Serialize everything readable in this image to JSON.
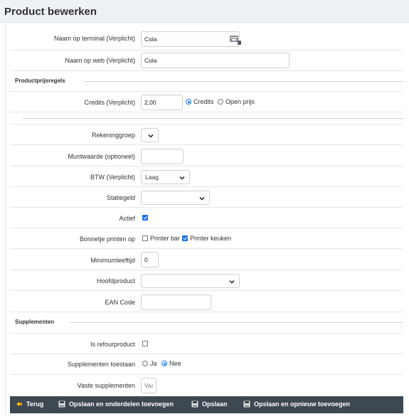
{
  "page": {
    "title": "Product bewerken"
  },
  "fields": {
    "naam_terminal": {
      "label": "Naam op terminal (Verplicht)",
      "value": "Cola"
    },
    "naam_web": {
      "label": "Naam op web (Verplicht)",
      "value": "Cola"
    },
    "credits": {
      "label": "Credits (Verplicht)",
      "value": "2,00",
      "option_credits": "Credits",
      "option_open": "Open prijs"
    },
    "rekeninggroep": {
      "label": "Rekeninggroep",
      "value": ""
    },
    "muntwaarde": {
      "label": "Muntwaarde (optioneel)",
      "value": ""
    },
    "btw": {
      "label": "BTW (Verplicht)",
      "value": "Laag"
    },
    "statiegeld": {
      "label": "Statiegeld",
      "value": ""
    },
    "actief": {
      "label": "Actief",
      "checked": true
    },
    "bonnetje": {
      "label": "Bonnetje printen op",
      "option_bar": "Printer bar",
      "option_keuken": "Printer keuken",
      "bar_checked": false,
      "keuken_checked": true
    },
    "minimumleeftijd": {
      "label": "Minimumleeftijd",
      "value": "0"
    },
    "hoofdproduct": {
      "label": "Hoofdproduct",
      "value": ""
    },
    "ean": {
      "label": "EAN Code",
      "value": ""
    },
    "refourproduct": {
      "label": "Is refourproduct",
      "checked": false
    },
    "supplementen_toestaan": {
      "label": "Supplementen toestaan",
      "option_ja": "Ja",
      "option_nee": "Nee",
      "selected": "Nee"
    },
    "vaste_supplementen": {
      "label": "Vaste supplementen",
      "placeholder": "Vaste"
    }
  },
  "sections": {
    "productprijsregels": "Productprijsregels",
    "supplementen": "Supplementen"
  },
  "footer": {
    "terug": "Terug",
    "opslaan_onderdelen": "Opslaan en onderdelen toevoegen",
    "opslaan": "Opslaan",
    "opslaan_opnieuw": "Opslaan en opnieuw toevoegen"
  },
  "colors": {
    "accent": "#1a73e8",
    "footer_bg": "#3d4852",
    "back_arrow": "#f5b400"
  }
}
